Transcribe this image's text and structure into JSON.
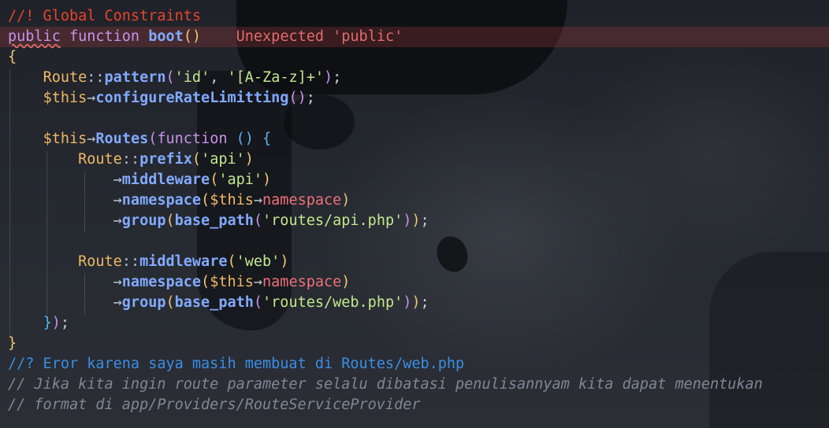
{
  "editor": {
    "lines": [
      {
        "kind": "alert-comment",
        "text": "//! Global Constraints"
      },
      {
        "kind": "signature",
        "kw1": "public",
        "kw2": "function",
        "name": "boot",
        "parens": "()",
        "error": "Unexpected 'public'"
      },
      {
        "kind": "brace",
        "text": "{"
      },
      {
        "kind": "route-pattern",
        "cls": "Route",
        "op": "::",
        "method": "pattern",
        "arg1": "'id'",
        "arg2": "'[A-Za-z]+'"
      },
      {
        "kind": "this-call",
        "var": "$this",
        "arrow": "→",
        "method": "configureRateLimitting"
      },
      {
        "kind": "blank"
      },
      {
        "kind": "routes-open",
        "var": "$this",
        "arrow": "→",
        "method": "Routes",
        "kw": "function",
        "parens": "()",
        "brace": "{"
      },
      {
        "kind": "chain-start",
        "cls": "Route",
        "op": "::",
        "method": "prefix",
        "arg": "'api'"
      },
      {
        "kind": "chain",
        "arrow": "→",
        "method": "middleware",
        "arg": "'api'"
      },
      {
        "kind": "chain-ns",
        "arrow": "→",
        "method": "namespace",
        "var": "$this",
        "prop": "namespace"
      },
      {
        "kind": "chain-group",
        "arrow": "→",
        "method": "group",
        "fn": "base_path",
        "arg": "'routes/api.php'"
      },
      {
        "kind": "blank"
      },
      {
        "kind": "chain-start",
        "cls": "Route",
        "op": "::",
        "method": "middleware",
        "arg": "'web'"
      },
      {
        "kind": "chain-ns",
        "arrow": "→",
        "method": "namespace",
        "var": "$this",
        "prop": "namespace"
      },
      {
        "kind": "chain-group",
        "arrow": "→",
        "method": "group",
        "fn": "base_path",
        "arg": "'routes/web.php'"
      },
      {
        "kind": "routes-close",
        "text": "});"
      },
      {
        "kind": "brace",
        "text": "}"
      },
      {
        "kind": "q-comment",
        "text": "//? Eror karena saya masih membuat di Routes/web.php"
      },
      {
        "kind": "comment",
        "text": "// Jika kita ingin route parameter selalu dibatasi penulisannyam kita dapat menentukan"
      },
      {
        "kind": "comment",
        "text": "// format di app/Providers/RouteServiceProvider"
      }
    ]
  }
}
